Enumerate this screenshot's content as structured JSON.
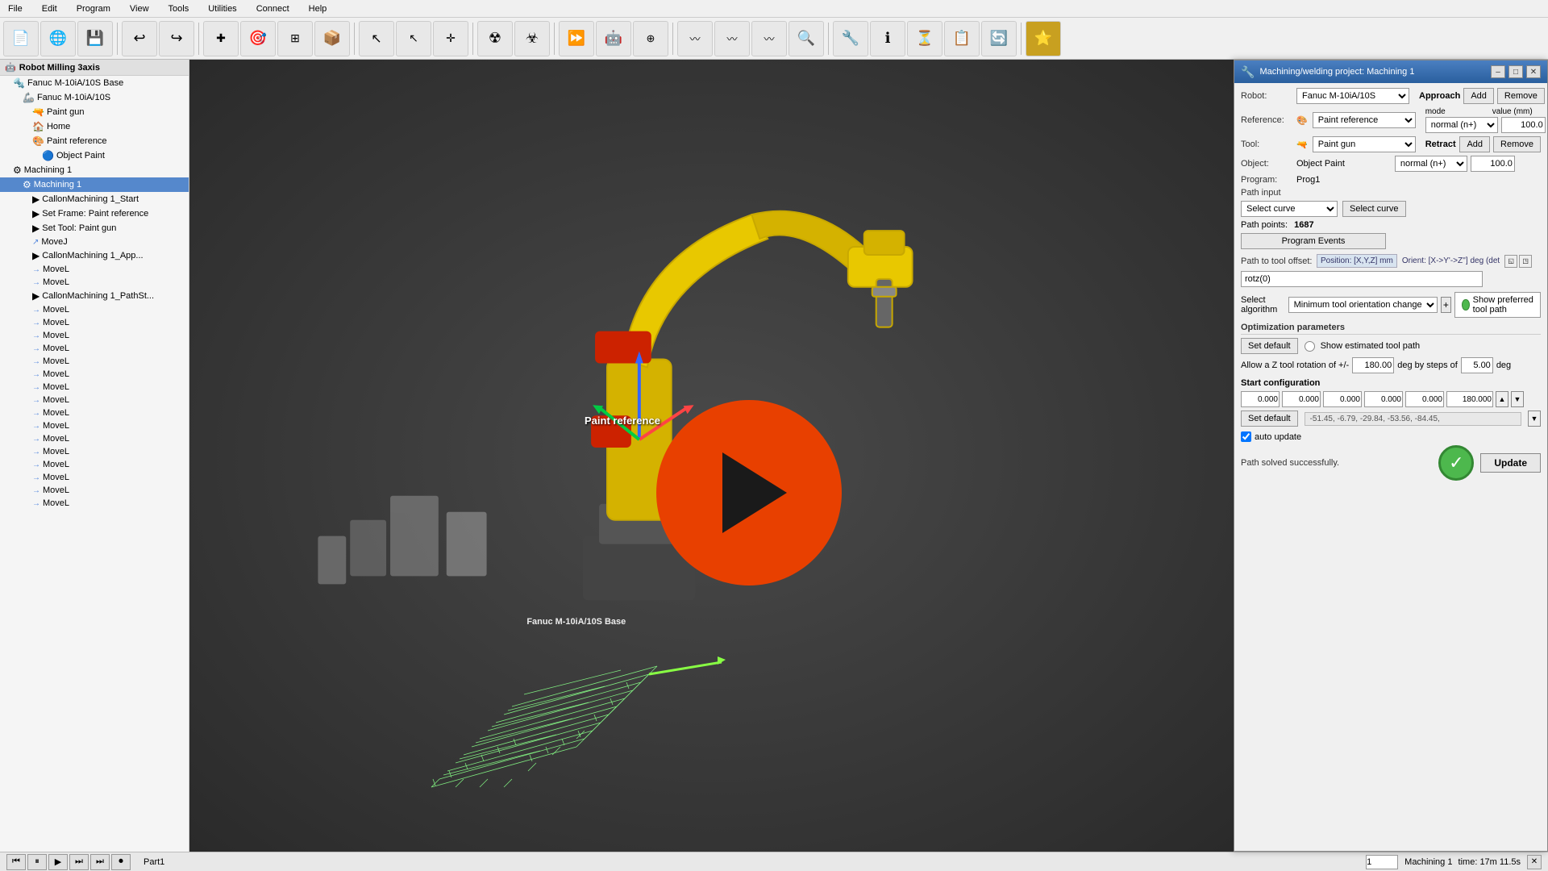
{
  "app": {
    "title": "Robot Milling 3axis"
  },
  "menu": {
    "items": [
      "File",
      "Edit",
      "Program",
      "View",
      "Tools",
      "Utilities",
      "Connect",
      "Help"
    ]
  },
  "toolbar": {
    "buttons": [
      {
        "name": "new",
        "icon": "📄"
      },
      {
        "name": "open",
        "icon": "🌐"
      },
      {
        "name": "save",
        "icon": "💾"
      },
      {
        "name": "undo",
        "icon": "↩"
      },
      {
        "name": "redo",
        "icon": "↪"
      },
      {
        "name": "add-point",
        "icon": "➕"
      },
      {
        "name": "target",
        "icon": "🎯"
      },
      {
        "name": "fit",
        "icon": "⬜"
      },
      {
        "name": "box",
        "icon": "📦"
      },
      {
        "name": "select",
        "icon": "↖"
      },
      {
        "name": "select-alt",
        "icon": "↖"
      },
      {
        "name": "move",
        "icon": "↔"
      },
      {
        "name": "radiation",
        "icon": "☢"
      },
      {
        "name": "radiation2",
        "icon": "☢"
      },
      {
        "name": "play",
        "icon": "⏩"
      },
      {
        "name": "robot",
        "icon": "🤖"
      },
      {
        "name": "add-robot",
        "icon": "➕"
      },
      {
        "name": "path",
        "icon": "〰"
      },
      {
        "name": "path2",
        "icon": "〰"
      },
      {
        "name": "path3",
        "icon": "〰"
      },
      {
        "name": "zoom",
        "icon": "🔍"
      },
      {
        "name": "wrench",
        "icon": "🔧"
      },
      {
        "name": "info",
        "icon": "ℹ"
      },
      {
        "name": "timer",
        "icon": "⏳"
      },
      {
        "name": "list",
        "icon": "📋"
      },
      {
        "name": "sync",
        "icon": "🔄"
      },
      {
        "name": "star",
        "icon": "⭐"
      }
    ]
  },
  "sidebar": {
    "root_label": "Robot Milling 3axis",
    "items": [
      {
        "id": "fanuc-base",
        "label": "Fanuc M-10iA/10S Base",
        "indent": 1,
        "icon": "🔩",
        "expanded": true
      },
      {
        "id": "fanuc-robot",
        "label": "Fanuc M-10iA/10S",
        "indent": 2,
        "icon": "🦾",
        "expanded": true
      },
      {
        "id": "paint-gun",
        "label": "Paint gun",
        "indent": 3,
        "icon": "🔫"
      },
      {
        "id": "home",
        "label": "Home",
        "indent": 3,
        "icon": "🏠"
      },
      {
        "id": "paint-ref",
        "label": "Paint reference",
        "indent": 3,
        "icon": "🎨"
      },
      {
        "id": "object-paint",
        "label": "Object Paint",
        "indent": 4,
        "icon": "🔵"
      },
      {
        "id": "machining1-group",
        "label": "Machining 1",
        "indent": 1,
        "icon": "⚙",
        "expanded": true
      },
      {
        "id": "machining1",
        "label": "Machining 1",
        "indent": 2,
        "icon": "⚙",
        "selected": true
      },
      {
        "id": "callmach1-start",
        "label": "CallonMachining 1_Start",
        "indent": 3,
        "icon": "▶"
      },
      {
        "id": "setframe",
        "label": "Set Frame: Paint reference",
        "indent": 3,
        "icon": "▶"
      },
      {
        "id": "settool",
        "label": "Set Tool: Paint gun",
        "indent": 3,
        "icon": "▶"
      },
      {
        "id": "movej1",
        "label": "MoveJ",
        "indent": 3,
        "icon": "↗"
      },
      {
        "id": "callmach1-app",
        "label": "CallonMachining 1_App...",
        "indent": 3,
        "icon": "▶"
      },
      {
        "id": "movel1",
        "label": "MoveL",
        "indent": 3,
        "icon": "→"
      },
      {
        "id": "movel2",
        "label": "MoveL",
        "indent": 3,
        "icon": "→"
      },
      {
        "id": "callmach-pathst",
        "label": "CallonMachining 1_PathSt...",
        "indent": 3,
        "icon": "▶"
      },
      {
        "id": "movel3",
        "label": "MoveL",
        "indent": 3,
        "icon": "→"
      },
      {
        "id": "movel4",
        "label": "MoveL",
        "indent": 3,
        "icon": "→"
      },
      {
        "id": "movel5",
        "label": "MoveL",
        "indent": 3,
        "icon": "→"
      },
      {
        "id": "movel6",
        "label": "MoveL",
        "indent": 3,
        "icon": "→"
      },
      {
        "id": "movel7",
        "label": "MoveL",
        "indent": 3,
        "icon": "→"
      },
      {
        "id": "movel8",
        "label": "MoveL",
        "indent": 3,
        "icon": "→"
      },
      {
        "id": "movel9",
        "label": "MoveL",
        "indent": 3,
        "icon": "→"
      },
      {
        "id": "movel10",
        "label": "MoveL",
        "indent": 3,
        "icon": "→"
      },
      {
        "id": "movel11",
        "label": "MoveL",
        "indent": 3,
        "icon": "→"
      },
      {
        "id": "movel12",
        "label": "MoveL",
        "indent": 3,
        "icon": "→"
      },
      {
        "id": "movel13",
        "label": "MoveL",
        "indent": 3,
        "icon": "→"
      },
      {
        "id": "movel14",
        "label": "MoveL",
        "indent": 3,
        "icon": "→"
      },
      {
        "id": "movel15",
        "label": "MoveL",
        "indent": 3,
        "icon": "→"
      },
      {
        "id": "movel16",
        "label": "MoveL",
        "indent": 3,
        "icon": "→"
      },
      {
        "id": "movel17",
        "label": "MoveL",
        "indent": 3,
        "icon": "→"
      },
      {
        "id": "movel18",
        "label": "MoveL",
        "indent": 3,
        "icon": "→"
      }
    ]
  },
  "dialog": {
    "title": "Machining/welding project: Machining 1",
    "robot_label": "Robot:",
    "robot_value": "Fanuc M-10iA/10S",
    "reference_label": "Reference:",
    "reference_value": "Paint reference",
    "tool_label": "Tool:",
    "tool_value": "Paint gun",
    "object_label": "Object:",
    "object_value": "Object Paint",
    "program_label": "Program:",
    "program_value": "Prog1",
    "path_input_label": "Path input",
    "select_curve_label": "Select curve",
    "select_curve2_label": "Select curve",
    "path_points_label": "Path points:",
    "path_points_value": "1687",
    "program_events_label": "Program Events",
    "approach_section": "Approach",
    "retract_section": "Retract",
    "add_label": "Add",
    "remove_label": "Remove",
    "mode_label": "mode",
    "value_label": "value (mm)",
    "normal_n_plus": "normal (n+)",
    "approach_value": "100.0",
    "retract_value": "100.0",
    "path_to_tool_label": "Path to tool offset:",
    "position_hint": "Position: [X,Y,Z] mm",
    "orient_hint": "Orient: [X->Y'->Z''] deg (det",
    "path_offset_value": "rotz(0)",
    "select_algo_label": "Select algorithm",
    "algo_value": "Minimum tool orientation change",
    "opt_params_label": "Optimization parameters",
    "set_default_label": "Set default",
    "show_preferred_tool_label": "Show preferred tool path",
    "show_estimated_tool_label": "Show estimated tool path",
    "z_rotation_label": "Allow a Z tool rotation of +/-",
    "z_rotation_value": "180.00",
    "deg_by_steps_label": "deg by steps of",
    "deg_steps_value": "5.00",
    "deg_label": "deg",
    "start_config_label": "Start configuration",
    "start_config_values": [
      "0.000",
      "0.000",
      "0.000",
      "0.000",
      "0.000",
      "180.000"
    ],
    "set_default2_label": "Set default",
    "start_config_preset": "-51.45,    -6.79,    -29.84,    -53.56,    -84.45,",
    "auto_update_label": "auto update",
    "status_label": "Path solved successfully.",
    "update_label": "Update"
  },
  "statusbar": {
    "left_text": "Part1",
    "machining_label": "Machining 1",
    "time_label": "time: 17m 11.5s",
    "page_num": "1",
    "close_icon": "✕"
  },
  "playback": {
    "buttons": [
      "⏮",
      "⏸",
      "▶",
      "⏭",
      "⏭",
      "⏺"
    ]
  },
  "viewport": {
    "label_paint_ref": "Paint reference",
    "label_robot_base": "Fanuc M-10iA/10S Base"
  }
}
